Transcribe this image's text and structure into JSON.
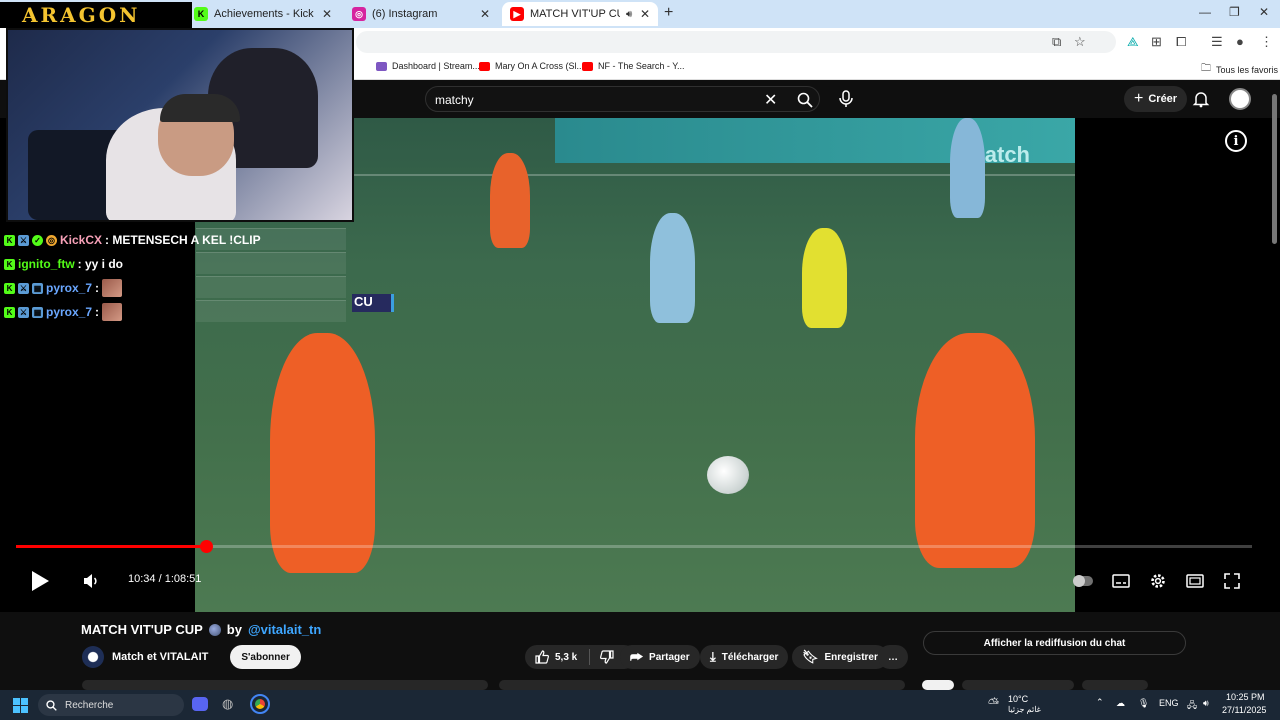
{
  "browser": {
    "tabs": [
      {
        "label": "Achievements - Kick Dashboard",
        "favicon_color": "#53fc18"
      },
      {
        "label": "(6) Instagram",
        "favicon_color": "#d6249f"
      },
      {
        "label": "MATCH VIT'UP CUP ● by",
        "favicon_color": "#ff0000"
      }
    ],
    "new_tab": "+",
    "bookmarks": [
      {
        "label": "Dashboard | Stream...",
        "color": "#7e57c2"
      },
      {
        "label": "Mary On A Cross (Sl...",
        "color": "#ff0000"
      },
      {
        "label": "NF - The Search - Y...",
        "color": "#ff0000"
      }
    ],
    "favorites_label": "Tous les favoris"
  },
  "overlay": {
    "brand": "ARAGON",
    "chat": [
      {
        "user": "KickCX",
        "user_color": "#f7a1b8",
        "message": ": METENSECH A KEL !CLIP",
        "badges": [
          "#53fc18",
          "#5b9bd5",
          "#53fc18",
          "#f0a830"
        ]
      },
      {
        "user": "ignito_ftw",
        "user_color": "#53fc18",
        "message": ": yy i do",
        "badges": [
          "#53fc18"
        ]
      },
      {
        "user": "pyrox_7",
        "user_color": "#6aa7ff",
        "message": ":",
        "badges": [
          "#53fc18",
          "#5b9bd5",
          "#5b9bd5"
        ],
        "emote": true
      },
      {
        "user": "pyrox_7",
        "user_color": "#6aa7ff",
        "message": ":",
        "badges": [
          "#53fc18",
          "#5b9bd5",
          "#5b9bd5"
        ],
        "emote": true
      }
    ]
  },
  "youtube": {
    "search_value": "matchy",
    "create_label": "Créer",
    "video": {
      "scoreboard_text": "CU",
      "board_text": "match",
      "time": "10:34 / 1:08:51",
      "progress_fraction": 0.154
    },
    "title": "MATCH VIT'UP CUP",
    "by": "by",
    "handle": "@vitalait_tn",
    "channel": "Match et VITALAIT",
    "subscribe_label": "S'abonner",
    "likes": "5,3 k",
    "share_label": "Partager",
    "download_label": "Télécharger",
    "save_label": "Enregistrer",
    "more_label": "…",
    "chat_replay_label": "Afficher la rediffusion du chat"
  },
  "taskbar": {
    "search_label": "Recherche",
    "weather_temp": "10°C",
    "weather_desc": "غائم جزئيا",
    "lang": "ENG",
    "time": "10:25 PM",
    "date": "27/11/2025"
  }
}
